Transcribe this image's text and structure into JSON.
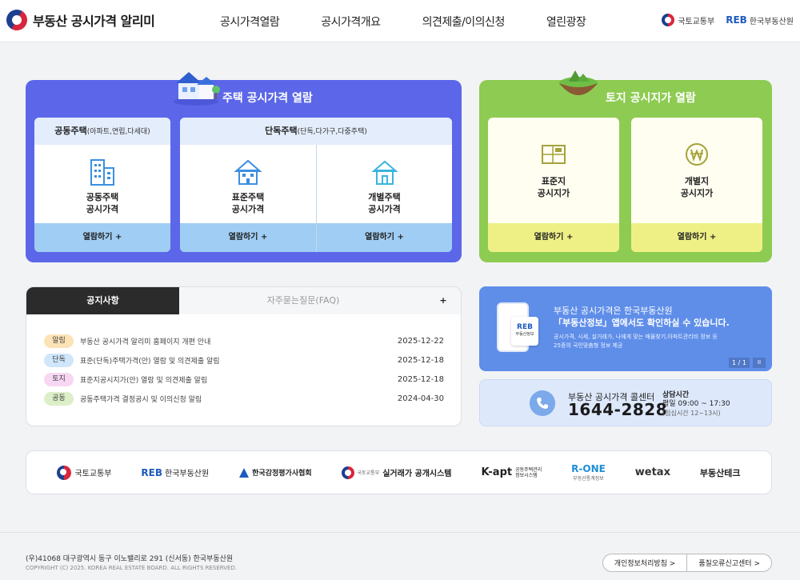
{
  "header": {
    "logo_text": "부동산 공시가격 알리미",
    "nav": [
      "공시가격열람",
      "공시가격개요",
      "의견제출/이의신청",
      "열린광장"
    ],
    "ministry": "국토교통부",
    "reb_logo": "REB",
    "reb_name": "한국부동산원"
  },
  "housing": {
    "title": "주택 공시가격 열람",
    "apt_head": "공동주택",
    "apt_head_sub": "(아파트,연립,다세대)",
    "apt_label_1": "공동주택",
    "apt_label_2": "공시가격",
    "detached_head": "단독주택",
    "detached_head_sub": "(단독,다가구,다중주택)",
    "std_label_1": "표준주택",
    "std_label_2": "공시가격",
    "ind_label_1": "개별주택",
    "ind_label_2": "공시가격",
    "view_btn": "열람하기 +"
  },
  "land": {
    "title": "토지 공시지가 열람",
    "std_label_1": "표준지",
    "std_label_2": "공시지가",
    "ind_label_1": "개별지",
    "ind_label_2": "공시지가",
    "view_btn": "열람하기 +"
  },
  "notice": {
    "tab_notice": "공지사항",
    "tab_faq": "자주묻는질문(FAQ)",
    "more": "+",
    "items": [
      {
        "badge": "알림",
        "badge_color": "#fbe3b6",
        "title": "부동산 공시가격 알리미 홈페이지 개편 안내",
        "date": "2025-12-22"
      },
      {
        "badge": "단독",
        "badge_color": "#cfe6fb",
        "title": "표준(단독)주택가격(안) 열람 및 의견제출 알림",
        "date": "2025-12-18"
      },
      {
        "badge": "토지",
        "badge_color": "#f7d7f3",
        "title": "표준지공시지가(안) 열람 및 의견제출 알림",
        "date": "2025-12-18"
      },
      {
        "badge": "공동",
        "badge_color": "#dcefc8",
        "title": "공동주택가격 결정공시 및 이의신청 알림",
        "date": "2024-04-30"
      }
    ]
  },
  "promo": {
    "line1": "부동산 공시가격은 한국부동산원",
    "line2": "「부동산정보」앱에서도 확인하실 수 있습니다.",
    "line3": "공시가격, 시세, 실거래가, 나에게 맞는 매물찾기,아파트관리비 정보 등",
    "line4": "25종의 국민맞춤형 정보 제공",
    "card_logo": "REB",
    "card_caption": "부동산정보",
    "pager": "1 / 1",
    "pause": "II"
  },
  "call": {
    "label": "부동산 공시가격 콜센터",
    "number": "1644-2828",
    "hours_title": "상담시간",
    "hours": "평일 09:00 ~ 17:30",
    "lunch": "(점심시간 12~13시)"
  },
  "partners": [
    "국토교통부",
    "한국부동산원",
    "한국감정평가사협회",
    "실거래가 공개시스템",
    "K-apt",
    "R-ONE",
    "wetax",
    "부동산테크"
  ],
  "partner_extras": {
    "reb": "REB",
    "molit_small": "국토교통부",
    "kapt_sub_1": "공동주택관리",
    "kapt_sub_2": "정보시스템",
    "rone_sub": "부동산통계정보"
  },
  "footer": {
    "address": "(우)41068 대구광역시 동구 이노밸리로 291 (신서동) 한국부동산원",
    "copyright": "COPYRIGHT (C) 2025. KOREA REAL ESTATE BOARD. ALL RIGHTS RESERVED.",
    "privacy": "개인정보처리방침 >",
    "error_report": "품질오류신고센터 >"
  }
}
